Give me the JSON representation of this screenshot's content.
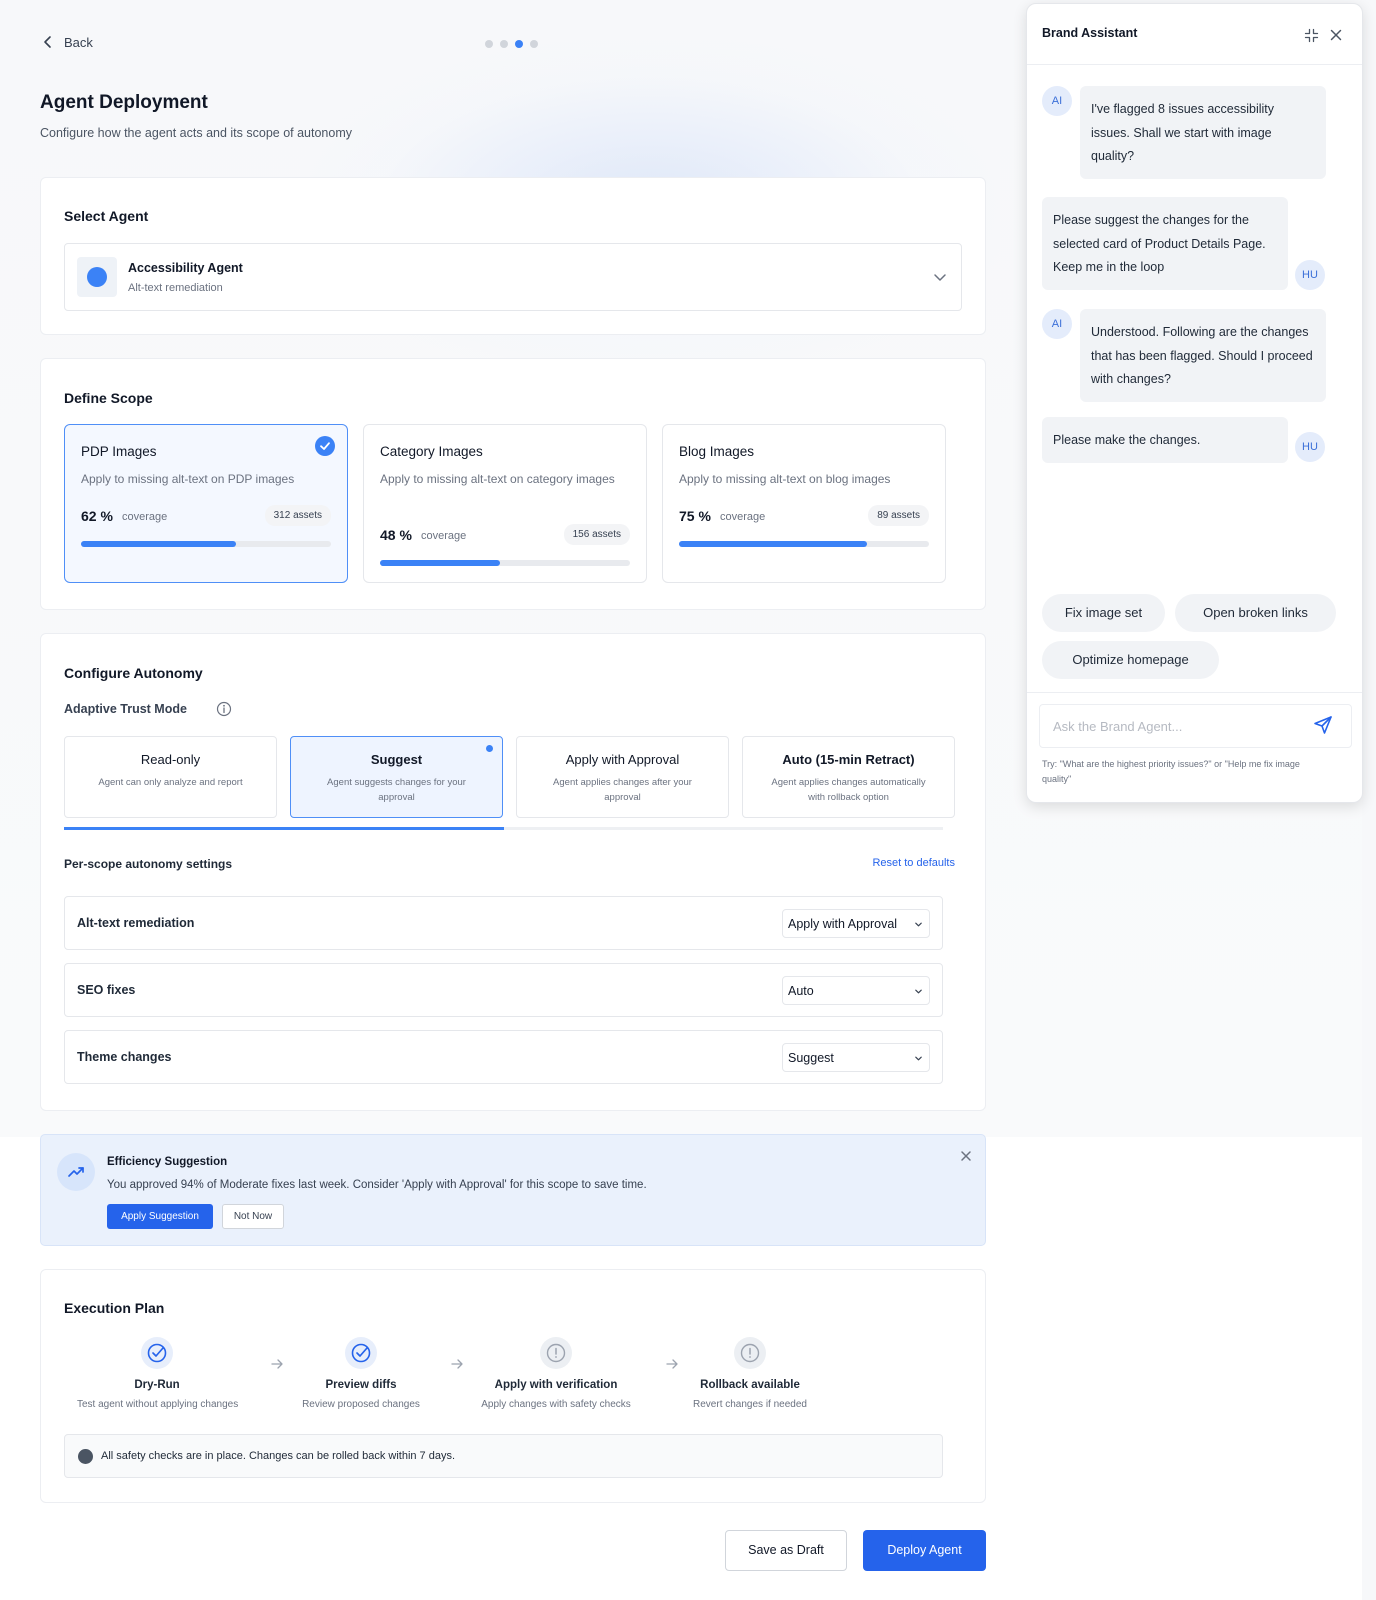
{
  "header": {
    "back_label": "Back",
    "title": "Agent Deployment",
    "subtitle": "Configure how the agent acts and its scope of autonomy",
    "step_count": 4,
    "active_step": 3
  },
  "select_agent": {
    "title": "Select Agent",
    "agent_name": "Accessibility Agent",
    "agent_desc": "Alt-text remediation"
  },
  "scope": {
    "title": "Define Scope",
    "cards": [
      {
        "name": "PDP Images",
        "desc": "Apply to missing alt-text on PDP images",
        "pct": "62 %",
        "coverage_label": "coverage",
        "assets": "312  assets",
        "fill": 0.62,
        "selected": true
      },
      {
        "name": "Category Images",
        "desc": "Apply to missing alt-text on category images",
        "pct": "48 %",
        "coverage_label": "coverage",
        "assets": "156  assets",
        "fill": 0.48,
        "selected": false
      },
      {
        "name": "Blog Images",
        "desc": "Apply to missing alt-text on blog images",
        "pct": "75 %",
        "coverage_label": "coverage",
        "assets": "89  assets",
        "fill": 0.75,
        "selected": false
      }
    ]
  },
  "autonomy": {
    "title": "Configure Autonomy",
    "trust_label": "Adaptive Trust Mode",
    "modes": [
      {
        "name": "Read-only",
        "desc": "Agent can only analyze and report"
      },
      {
        "name": "Suggest",
        "desc": "Agent suggests changes for your approval"
      },
      {
        "name": "Apply with Approval",
        "desc": "Agent applies changes after your approval"
      },
      {
        "name": "Auto (15-min Retract)",
        "desc": "Agent applies changes automatically with rollback option"
      }
    ],
    "selected_mode": 1,
    "mode_progress": 0.5,
    "per_scope_title": "Per-scope autonomy settings",
    "reset_label": "Reset to defaults",
    "settings": [
      {
        "label": "Alt-text remediation",
        "value": "Apply with Approval"
      },
      {
        "label": "SEO fixes",
        "value": "Auto"
      },
      {
        "label": "Theme changes",
        "value": "Suggest"
      }
    ]
  },
  "efficiency": {
    "title": "Efficiency Suggestion",
    "text": "You approved 94% of Moderate fixes last week. Consider 'Apply with Approval' for this scope to save time.",
    "apply_label": "Apply Suggestion",
    "dismiss_label": "Not Now"
  },
  "execution": {
    "title": "Execution Plan",
    "steps": [
      {
        "name": "Dry-Run",
        "desc": "Test agent without applying changes",
        "status": "done"
      },
      {
        "name": "Preview diffs",
        "desc": "Review proposed changes",
        "status": "done"
      },
      {
        "name": "Apply with verification",
        "desc": "Apply changes with safety checks",
        "status": "pending"
      },
      {
        "name": "Rollback available",
        "desc": "Revert changes if needed",
        "status": "pending"
      }
    ],
    "safety_text": "All safety checks are in place. Changes can be rolled back within 7 days."
  },
  "footer": {
    "draft_label": "Save as Draft",
    "deploy_label": "Deploy Agent"
  },
  "chat": {
    "title": "Brand Assistant",
    "messages": [
      {
        "from": "AI",
        "text": "I've flagged 8 issues accessibility issues. Shall we start with image quality?"
      },
      {
        "from": "HU",
        "text": "Please suggest the changes for the selected card of Product Details Page. Keep me in the loop"
      },
      {
        "from": "AI",
        "text": "Understood. Following are the changes that has been flagged. Should I proceed with changes?"
      },
      {
        "from": "HU",
        "text": "Please make the changes."
      }
    ],
    "chips": [
      "Fix image set",
      "Open broken links",
      "Optimize homepage"
    ],
    "input_placeholder": "Ask the Brand Agent...",
    "hint": "Try: \"What are the highest priority issues?\" or \"Help me fix image quality\""
  },
  "colors": {
    "accent": "#3b82f6",
    "primary_button": "#2563eb",
    "suggestion_bg": "#eaf1fc"
  }
}
